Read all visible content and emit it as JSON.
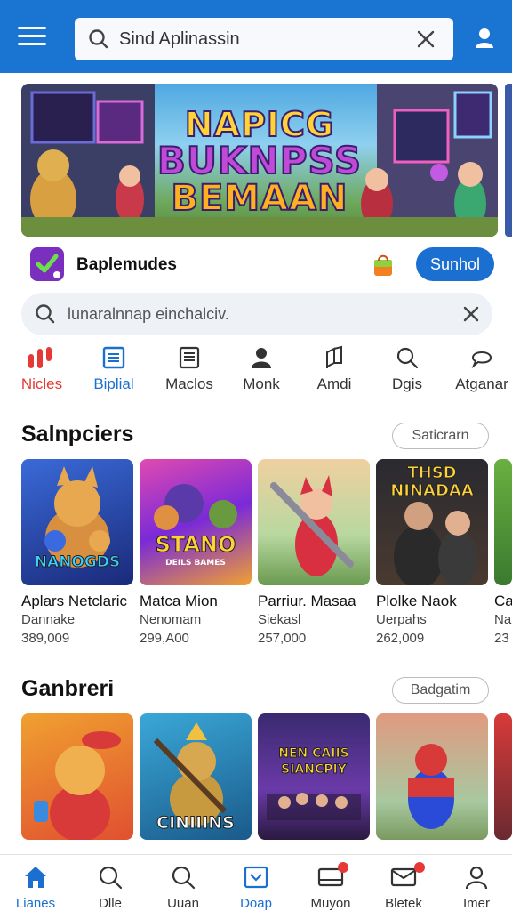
{
  "header": {
    "search_text": "Sind Aplinassin"
  },
  "banner": {
    "line1": "NAPICG",
    "line2": "BUKNPSS",
    "line3": "BEMAAN"
  },
  "app": {
    "name": "Baplemudes",
    "action_label": "Sunhol"
  },
  "search": {
    "text": "lunaralnnap einchalciv."
  },
  "categories": [
    {
      "label": "Nicles",
      "icon": "trending-icon",
      "color": "#e53935"
    },
    {
      "label": "Biplial",
      "icon": "list-icon",
      "color": "#1a6fd0"
    },
    {
      "label": "Maclos",
      "icon": "document-icon",
      "color": "#333333"
    },
    {
      "label": "Monk",
      "icon": "person-icon",
      "color": "#333333"
    },
    {
      "label": "Amdi",
      "icon": "flag-icon",
      "color": "#333333"
    },
    {
      "label": "Dgis",
      "icon": "search-icon",
      "color": "#333333"
    },
    {
      "label": "Atganar",
      "icon": "chat-icon",
      "color": "#333333"
    }
  ],
  "section1": {
    "title": "Salnpciers",
    "button": "Saticrarn",
    "cards": [
      {
        "thumb_text": "NANOGDS",
        "name": "Aplars Netclaric",
        "sub": "Dannake",
        "count": "389,009"
      },
      {
        "thumb_text": "STANO",
        "thumb_sub": "DEILS BAMES",
        "name": "Matca Mion",
        "sub": "Nenomam",
        "count": "299,A00"
      },
      {
        "thumb_text": "",
        "name": "Parriur. Masaa",
        "sub": "Siekasl",
        "count": "257,000"
      },
      {
        "thumb_text": "THSD NINADAA",
        "name": "Plolke Naok",
        "sub": "Uerpahs",
        "count": "262,009"
      },
      {
        "thumb_text": "",
        "name": "Ca",
        "sub": "Na",
        "count": "23"
      }
    ]
  },
  "section2": {
    "title": "Ganbreri",
    "button": "Badgatim",
    "cards": [
      {
        "thumb_text": ""
      },
      {
        "thumb_text": "CINIIINS"
      },
      {
        "thumb_text": "NEN CAIIS SIANCPIY"
      },
      {
        "thumb_text": ""
      },
      {
        "thumb_text": ""
      }
    ]
  },
  "bottom_nav": [
    {
      "label": "Lianes",
      "icon": "home-icon",
      "active": true
    },
    {
      "label": "Dlle",
      "icon": "search-icon",
      "active": false
    },
    {
      "label": "Uuan",
      "icon": "search-icon",
      "active": false
    },
    {
      "label": "Doap",
      "icon": "download-box-icon",
      "active": false
    },
    {
      "label": "Muyon",
      "icon": "inbox-icon",
      "active": false,
      "badge": true
    },
    {
      "label": "Bletek",
      "icon": "mail-icon",
      "active": false,
      "badge": true
    },
    {
      "label": "Imer",
      "icon": "person-icon",
      "active": false
    }
  ]
}
